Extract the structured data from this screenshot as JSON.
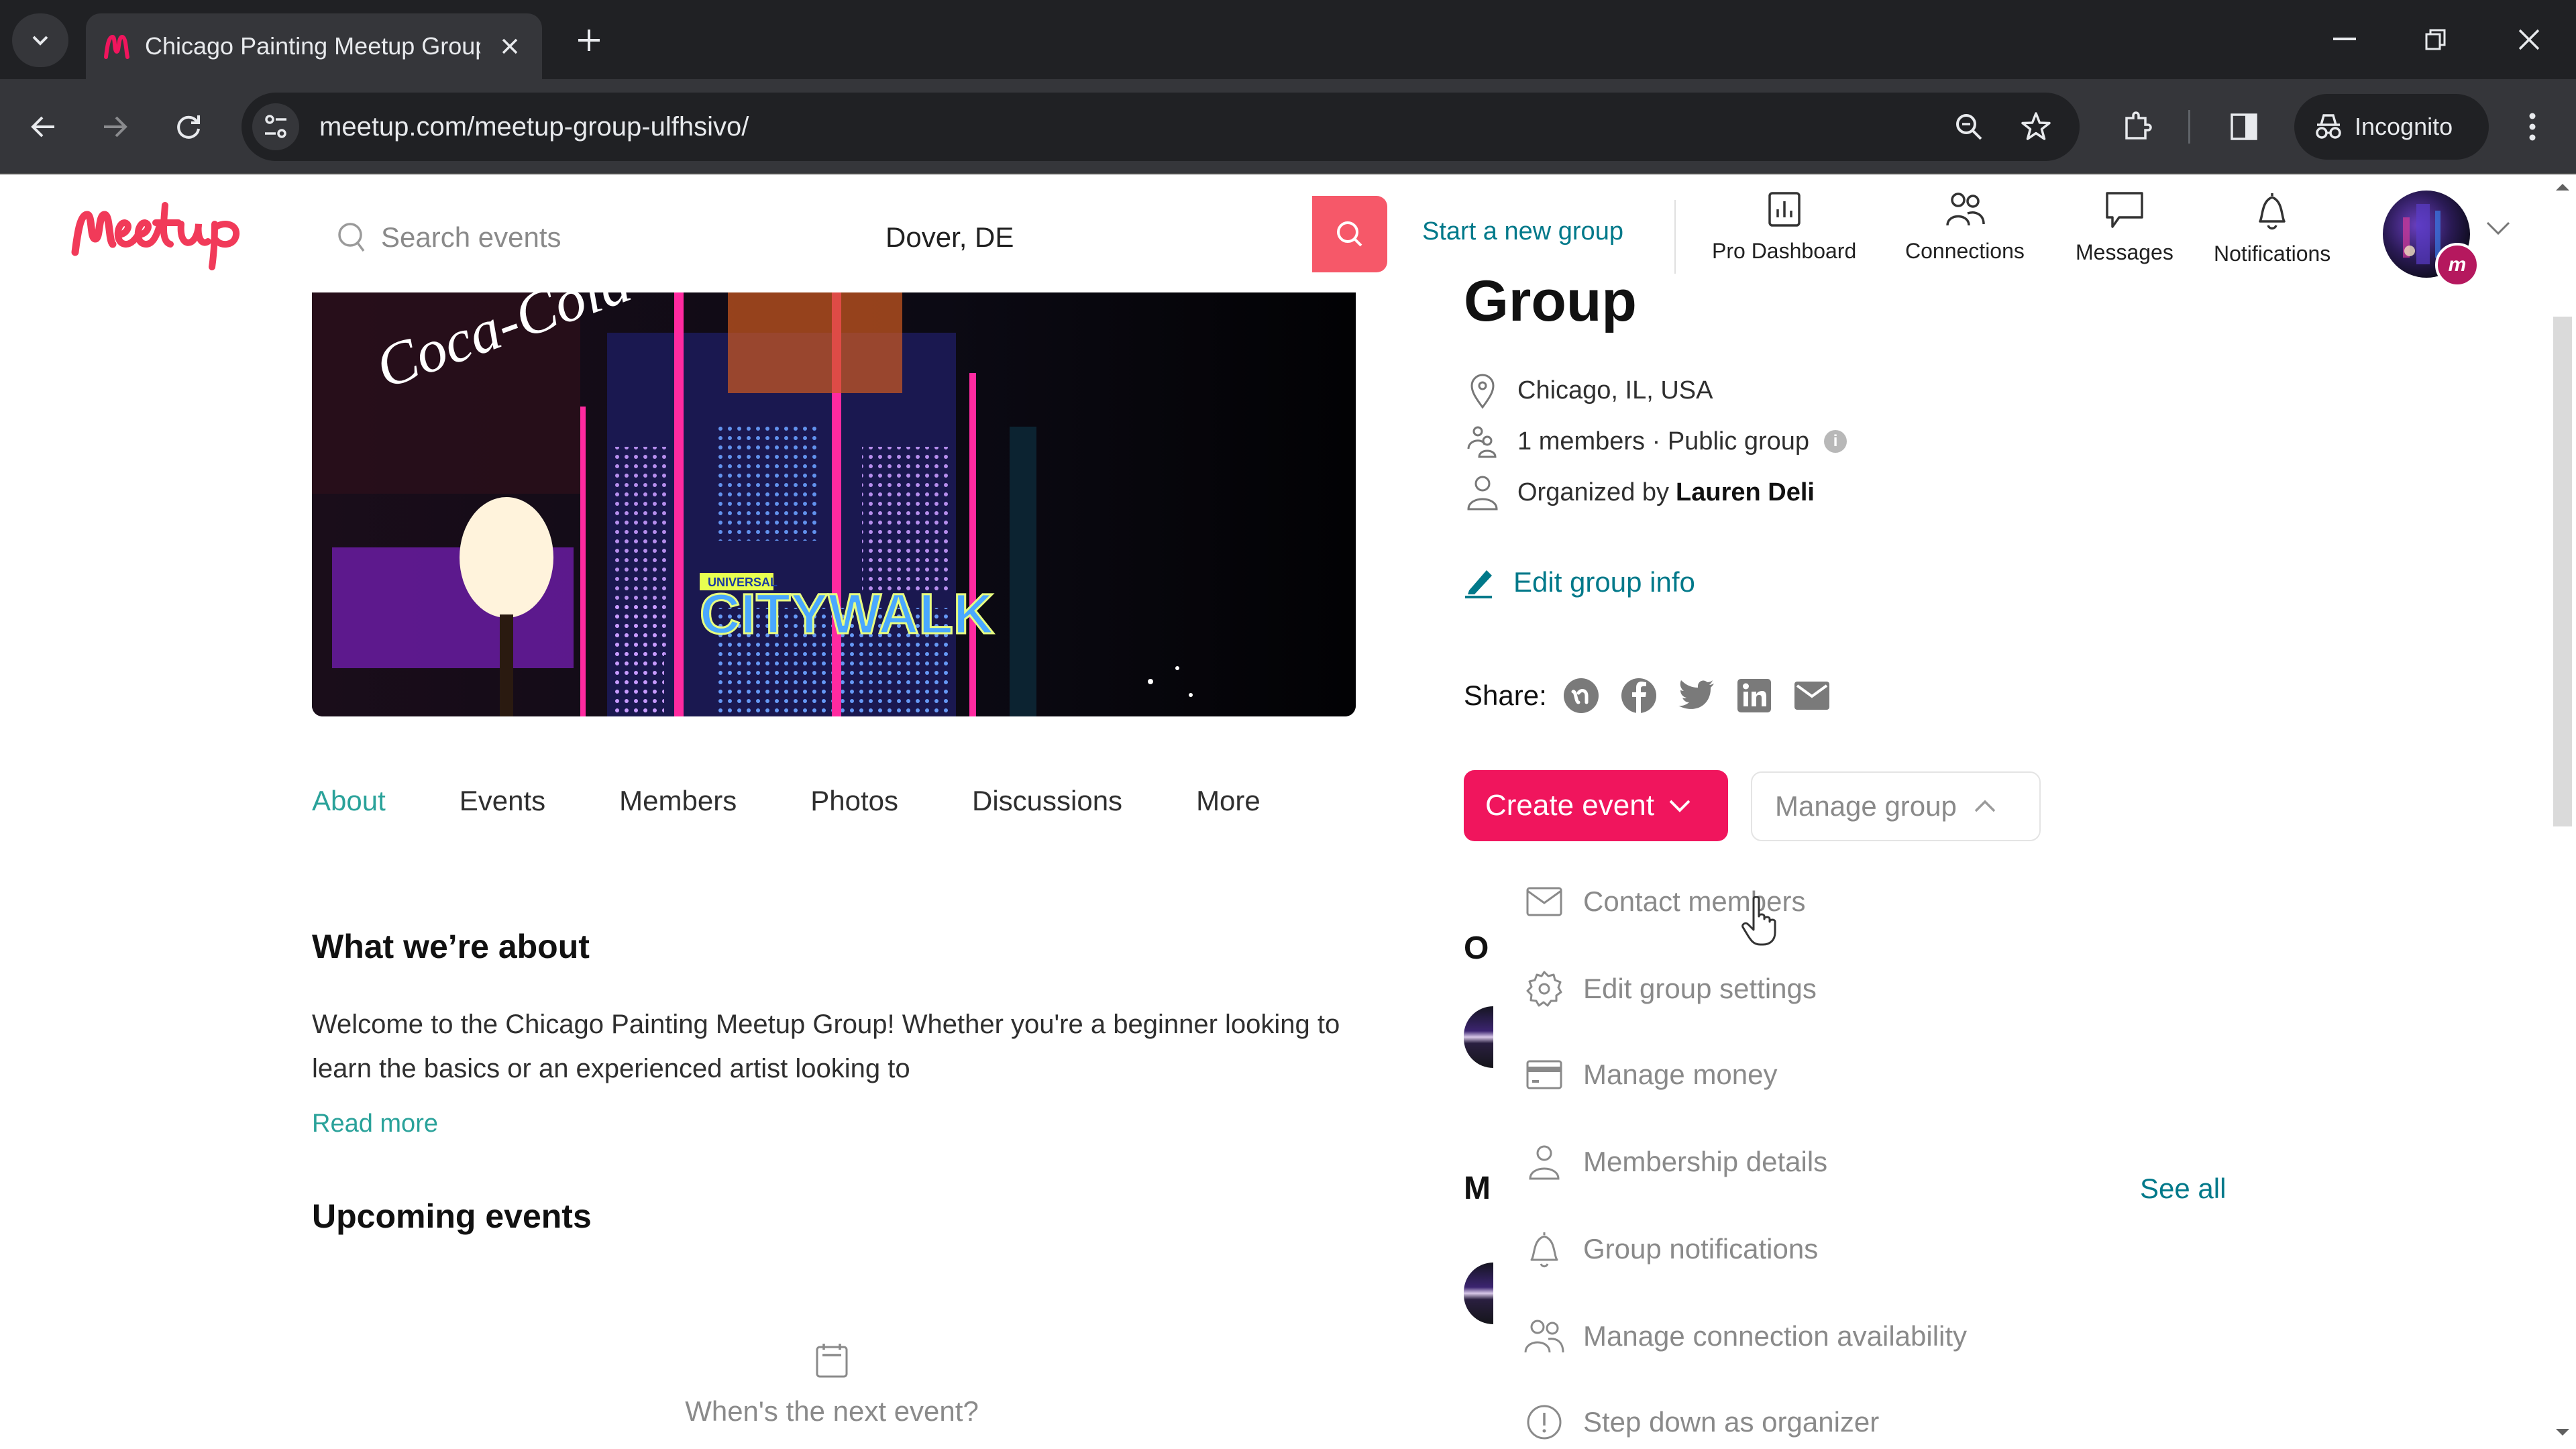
{
  "browser": {
    "tab_title": "Chicago Painting Meetup Group",
    "url": "meetup.com/meetup-group-ulfhsivo/",
    "profile_label": "Incognito"
  },
  "header": {
    "search_placeholder": "Search events",
    "location_value": "Dover, DE",
    "start_group": "Start a new group",
    "nav": [
      {
        "label": "Pro Dashboard",
        "icon": "bar-chart-icon"
      },
      {
        "label": "Connections",
        "icon": "people-icon"
      },
      {
        "label": "Messages",
        "icon": "chat-bubble-icon"
      },
      {
        "label": "Notifications",
        "icon": "bell-icon"
      }
    ],
    "avatar_badge": "m"
  },
  "banner": {
    "sign_text": "CITYWALK",
    "sign_small": "UNIVERSAL"
  },
  "group": {
    "title_fragment": "Group",
    "location": "Chicago, IL, USA",
    "members": "1 members · Public group",
    "organized_prefix": "Organized by",
    "organizer": "Lauren Deli",
    "edit_info": "Edit group info",
    "share_label": "Share:",
    "share_targets": [
      "meetup",
      "facebook",
      "twitter",
      "linkedin",
      "email"
    ]
  },
  "actions": {
    "create_event": "Create event",
    "manage_group": "Manage group"
  },
  "manage_menu": [
    {
      "label": "Contact members",
      "icon": "envelope-icon"
    },
    {
      "label": "Edit group settings",
      "icon": "gear-icon"
    },
    {
      "label": "Manage money",
      "icon": "credit-card-icon"
    },
    {
      "label": "Membership details",
      "icon": "person-icon"
    },
    {
      "label": "Group notifications",
      "icon": "bell-icon"
    },
    {
      "label": "Manage connection availability",
      "icon": "people-icon"
    },
    {
      "label": "Step down as organizer",
      "icon": "alert-circle-icon"
    }
  ],
  "sidebar_behind": {
    "heading_1": "O",
    "heading_2": "M",
    "see_all": "See all"
  },
  "tabs": [
    {
      "label": "About",
      "active": true
    },
    {
      "label": "Events",
      "active": false
    },
    {
      "label": "Members",
      "active": false
    },
    {
      "label": "Photos",
      "active": false
    },
    {
      "label": "Discussions",
      "active": false
    },
    {
      "label": "More",
      "active": false
    }
  ],
  "about": {
    "title": "What we’re about",
    "text": "Welcome to the Chicago Painting Meetup Group! Whether you're a beginner looking to learn the basics or an experienced artist looking to",
    "read_more": "Read more"
  },
  "events": {
    "title": "Upcoming events",
    "empty_text": "When's the next event?"
  },
  "colors": {
    "brand_red": "#f65869",
    "create_pink": "#f0155d",
    "teal_link": "#00798a",
    "tab_active": "#2aa29a"
  }
}
